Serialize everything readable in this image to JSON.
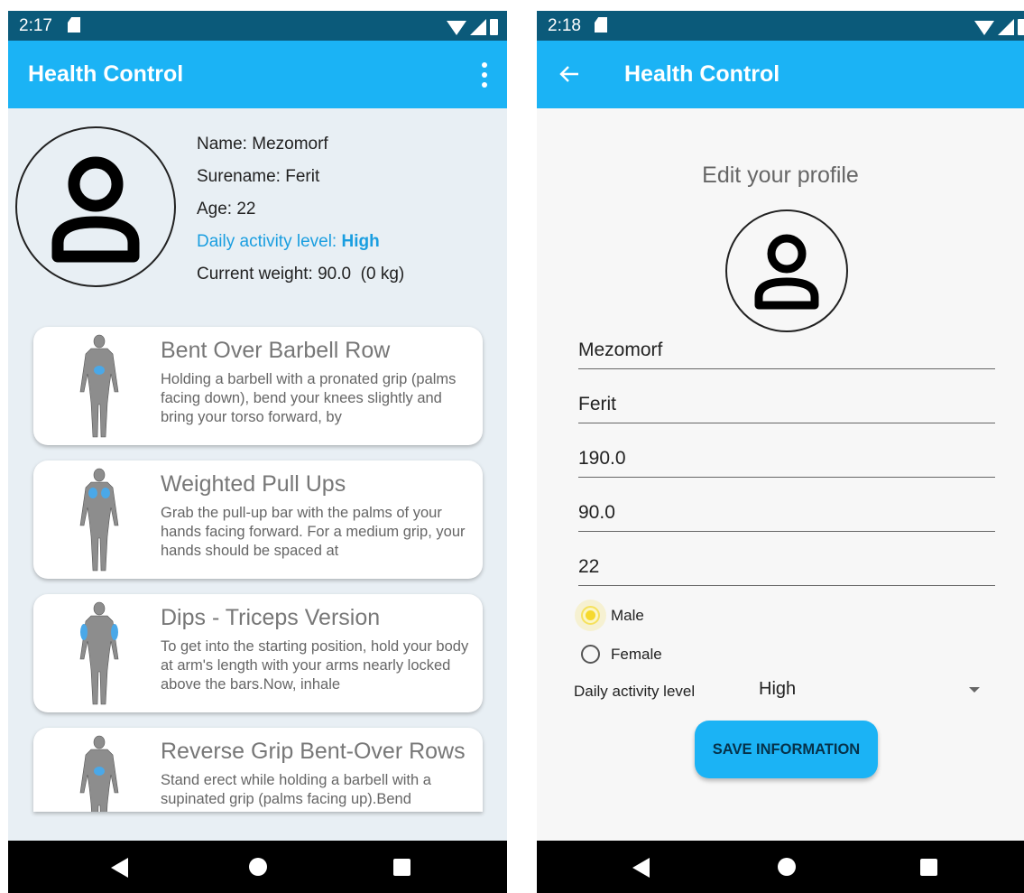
{
  "colors": {
    "status_bar": "#0b5a7a",
    "app_bar": "#1bb3f5",
    "accent_text": "#1a9ee0",
    "radio_selected": "#f6d92d",
    "left_background": "#e8eff4"
  },
  "left_screen": {
    "status_bar": {
      "time": "2:17",
      "icons": [
        "sd-card-icon",
        "wifi-icon",
        "signal-icon",
        "battery-icon"
      ]
    },
    "app_bar": {
      "title": "Health Control",
      "menu_icon": "more-vert-icon"
    },
    "profile": {
      "avatar_icon": "person-icon",
      "name": "Name: Mezomorf",
      "surname": "Surename: Ferit",
      "age": "Age: 22",
      "activity_label": "Daily activity level: ",
      "activity_value": "High",
      "weight": "Current weight: 90.0  (0 kg)"
    },
    "exercises": [
      {
        "title": "Bent Over Barbell Row",
        "description": "Holding a barbell with a pronated grip (palms facing down), bend your knees slightly and bring your torso forward, by"
      },
      {
        "title": "Weighted Pull Ups",
        "description": "Grab the pull-up bar with the palms of your hands facing forward. For a medium grip, your hands should be spaced at"
      },
      {
        "title": "Dips - Triceps Version",
        "description": "To get into the starting position, hold your body at arm's length with your arms nearly locked above the bars.Now, inhale"
      },
      {
        "title": "Reverse Grip Bent-Over Rows",
        "description": "Stand erect while holding a barbell with a supinated grip (palms facing up).Bend"
      }
    ],
    "nav_bar": [
      "back-icon",
      "home-icon",
      "recents-icon"
    ]
  },
  "right_screen": {
    "status_bar": {
      "time": "2:18",
      "icons": [
        "sd-card-icon",
        "wifi-icon",
        "signal-icon",
        "battery-icon"
      ]
    },
    "app_bar": {
      "title": "Health Control",
      "back_icon": "arrow-back-icon"
    },
    "heading": "Edit your profile",
    "avatar_icon": "person-icon",
    "fields": {
      "name": "Mezomorf",
      "surname": "Ferit",
      "height": "190.0",
      "weight": "90.0",
      "age": "22"
    },
    "gender": {
      "options": [
        "Male",
        "Female"
      ],
      "selected": "Male"
    },
    "activity": {
      "label": "Daily activity level",
      "selected": "High"
    },
    "save_button": "SAVE INFORMATION",
    "nav_bar": [
      "back-icon",
      "home-icon",
      "recents-icon"
    ]
  }
}
